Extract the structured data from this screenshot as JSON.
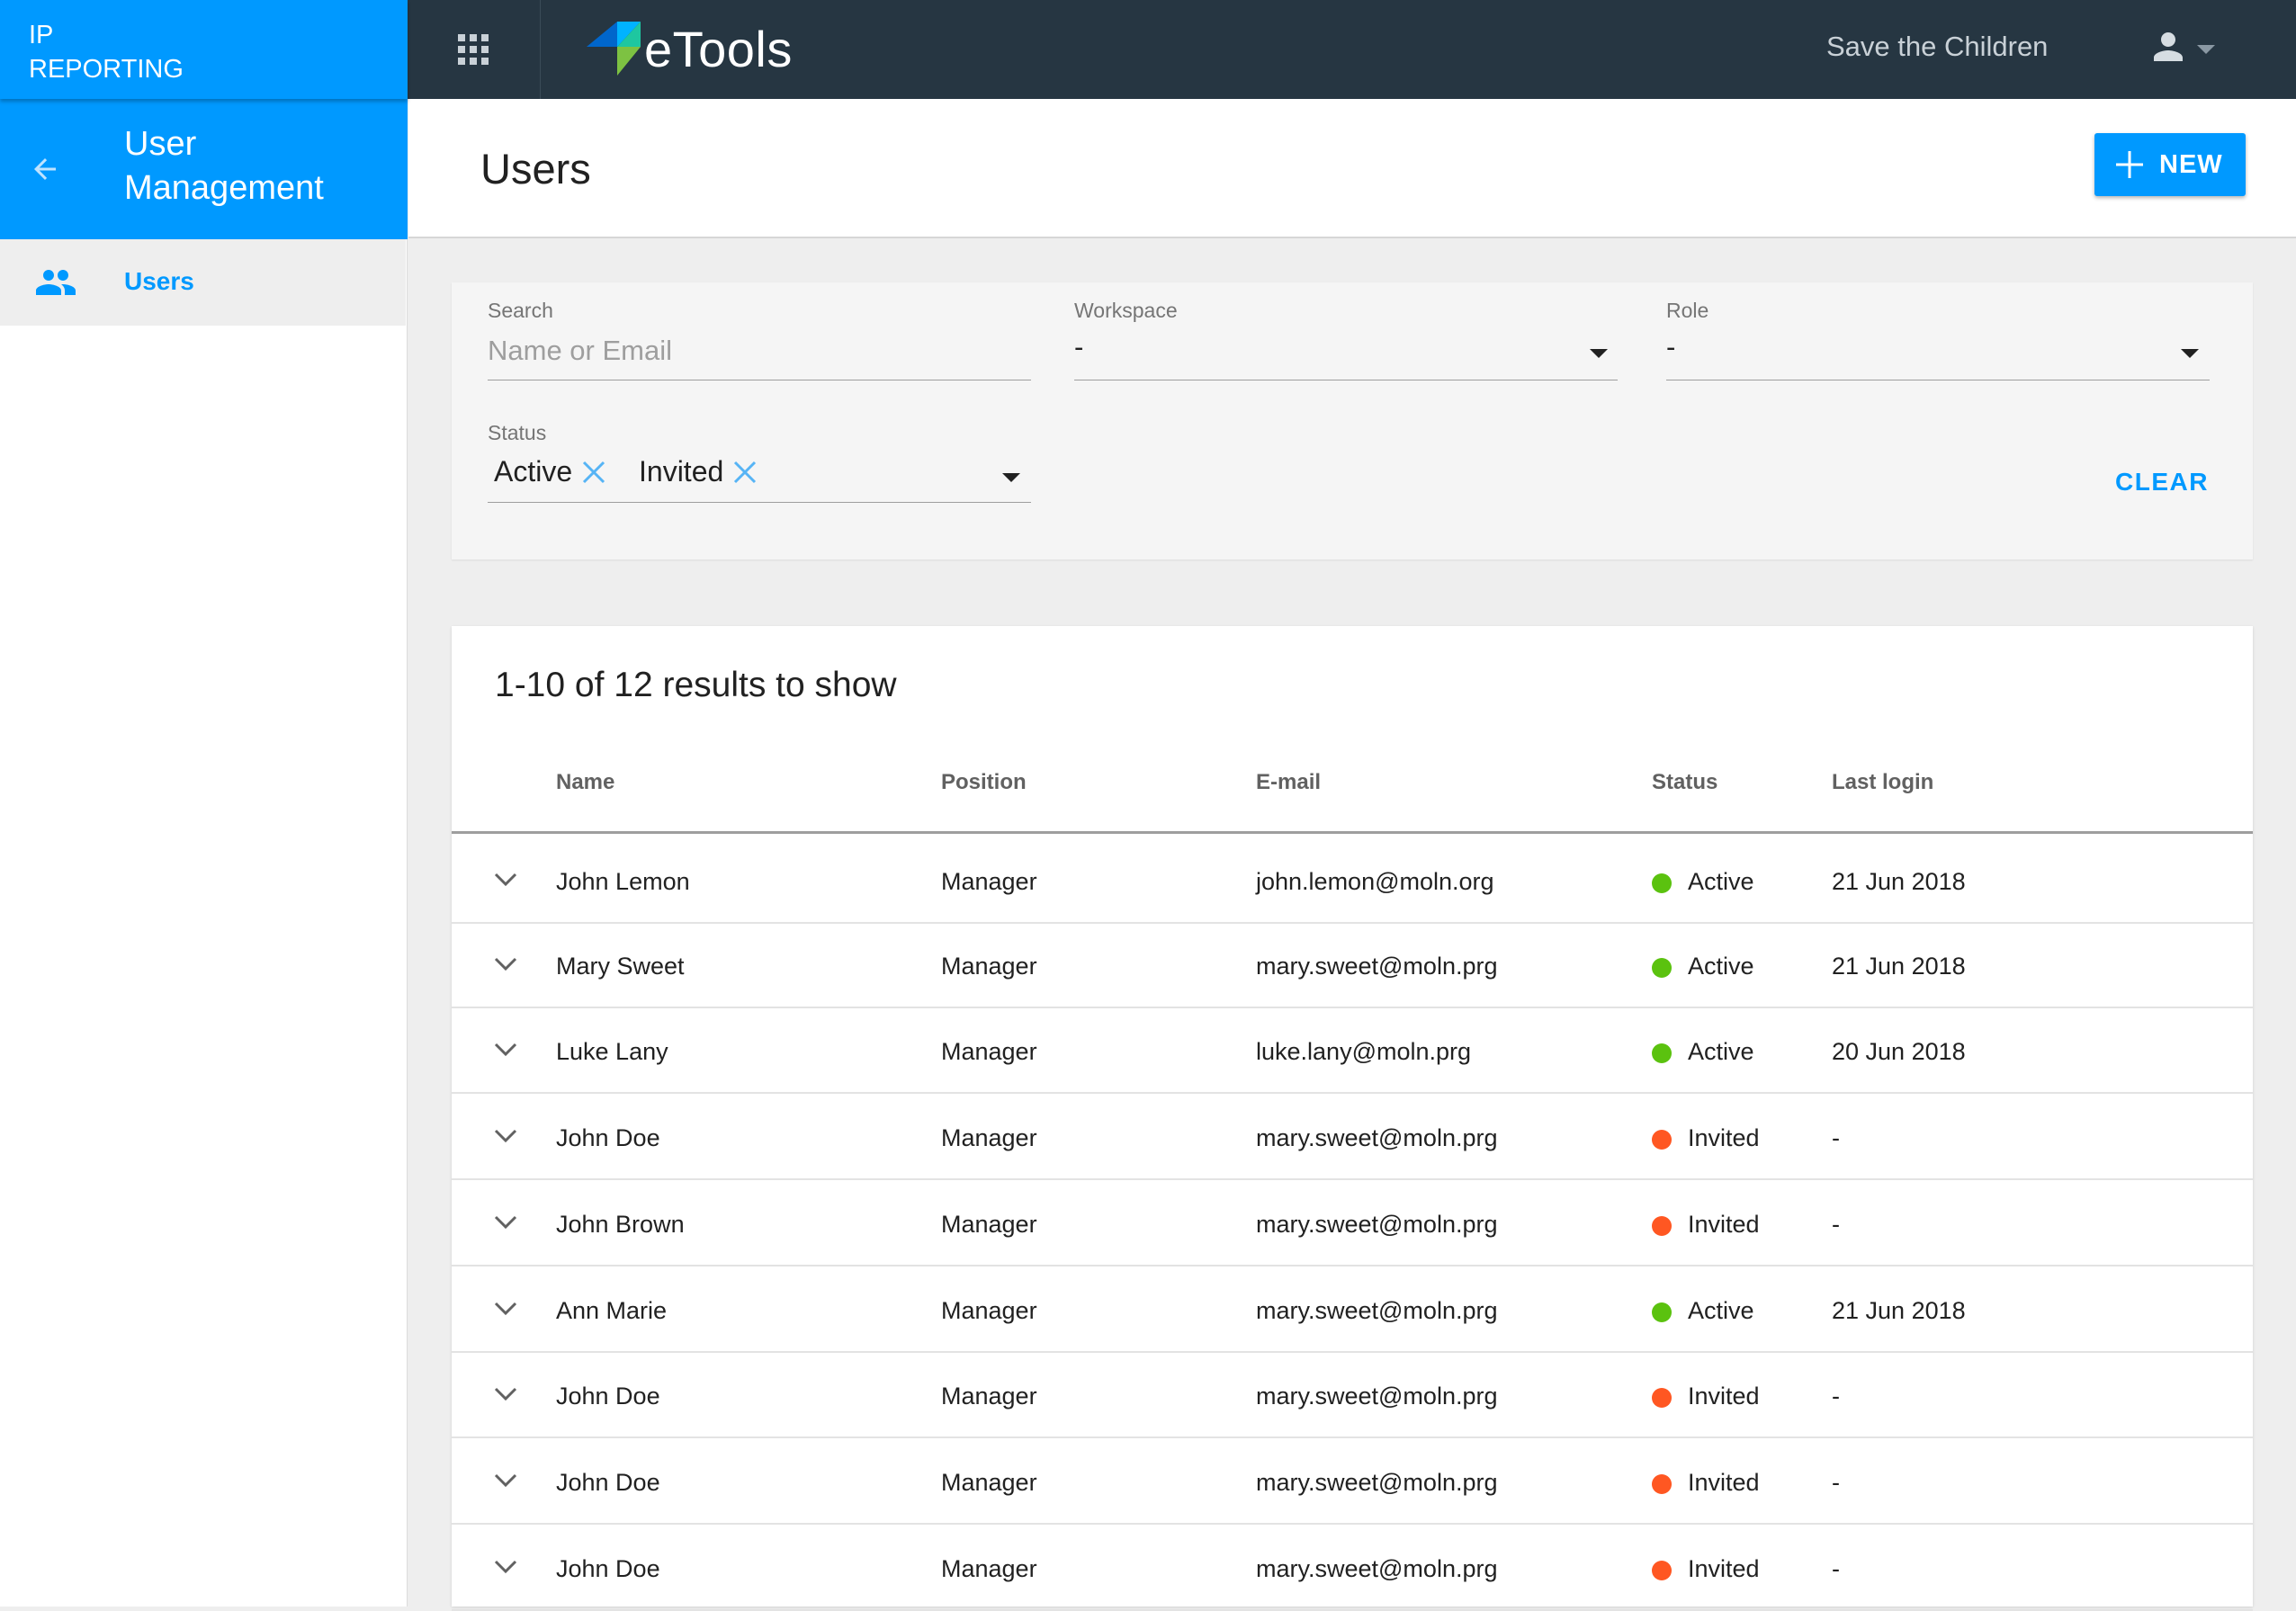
{
  "app": {
    "section_line1": "IP",
    "section_line2": "REPORTING",
    "logo_text": "eTools",
    "organization": "Save the Children"
  },
  "sidebar": {
    "header_title_line1": "User",
    "header_title_line2": "Management",
    "items": [
      {
        "label": "Users",
        "icon": "people-icon",
        "active": true
      }
    ]
  },
  "page": {
    "title": "Users",
    "new_button_label": "NEW"
  },
  "filters": {
    "search": {
      "label": "Search",
      "placeholder": "Name or Email",
      "value": ""
    },
    "workspace": {
      "label": "Workspace",
      "value": "-"
    },
    "role": {
      "label": "Role",
      "value": "-"
    },
    "status": {
      "label": "Status",
      "selected": [
        "Active",
        "Invited"
      ]
    },
    "clear_label": "CLEAR"
  },
  "table": {
    "summary": "1-10 of 12 results to show",
    "columns": [
      "Name",
      "Position",
      "E-mail",
      "Status",
      "Last login"
    ],
    "rows": [
      {
        "name": "John Lemon",
        "position": "Manager",
        "email": "john.lemon@moln.org",
        "status": "Active",
        "last_login": "21 Jun 2018"
      },
      {
        "name": "Mary Sweet",
        "position": "Manager",
        "email": "mary.sweet@moln.prg",
        "status": "Active",
        "last_login": "21 Jun 2018"
      },
      {
        "name": "Luke Lany",
        "position": "Manager",
        "email": "luke.lany@moln.prg",
        "status": "Active",
        "last_login": "20 Jun 2018"
      },
      {
        "name": "John Doe",
        "position": "Manager",
        "email": "mary.sweet@moln.prg",
        "status": "Invited",
        "last_login": "-"
      },
      {
        "name": "John Brown",
        "position": "Manager",
        "email": "mary.sweet@moln.prg",
        "status": "Invited",
        "last_login": "-"
      },
      {
        "name": "Ann Marie",
        "position": "Manager",
        "email": "mary.sweet@moln.prg",
        "status": "Active",
        "last_login": "21 Jun 2018"
      },
      {
        "name": "John Doe",
        "position": "Manager",
        "email": "mary.sweet@moln.prg",
        "status": "Invited",
        "last_login": "-"
      },
      {
        "name": "John Doe",
        "position": "Manager",
        "email": "mary.sweet@moln.prg",
        "status": "Invited",
        "last_login": "-"
      },
      {
        "name": "John Doe",
        "position": "Manager",
        "email": "mary.sweet@moln.prg",
        "status": "Invited",
        "last_login": "-"
      }
    ]
  },
  "colors": {
    "primary": "#0099ff",
    "topbar": "#263642",
    "status_active": "#5bc20f",
    "status_invited": "#ff5722"
  }
}
